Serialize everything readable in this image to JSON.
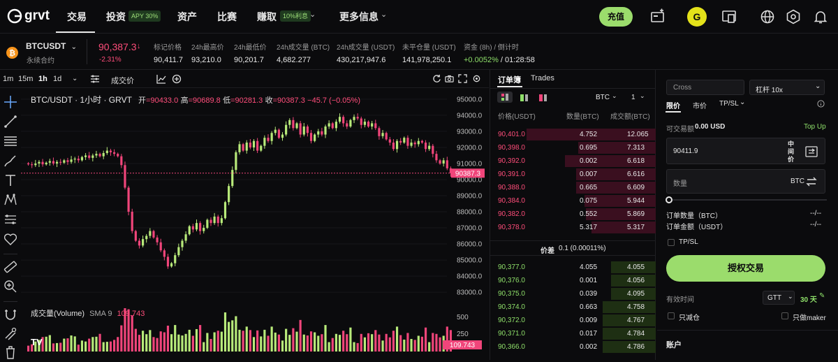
{
  "nav": {
    "logo": "grvt",
    "items": [
      "交易",
      "投资",
      "资产",
      "比赛",
      "赚取",
      "更多信息"
    ],
    "invest_badge": "APY 30%",
    "earn_badge": "10%利息",
    "deposit_label": "充值",
    "avatar_letter": "G"
  },
  "ticker": {
    "symbol": "BTCUSDT",
    "sub": "永续合约",
    "price": "90,387.3",
    "price_arrow": "↓",
    "change": "-2.31%",
    "stats": [
      {
        "label": "标记价格",
        "value": "90,411.7"
      },
      {
        "label": "24h最高价",
        "value": "93,210.0"
      },
      {
        "label": "24h最低价",
        "value": "90,201.7"
      },
      {
        "label": "24h成交量 (BTC)",
        "value": "4,682.277"
      },
      {
        "label": "24h成交量 (USDT)",
        "value": "430,217,947.6"
      },
      {
        "label": "未平仓量 (USDT)",
        "value": "141,978,250.1"
      }
    ],
    "funding_label": "资金 (8h) / 倒计时",
    "funding_rate": "+0.0052%",
    "funding_countdown": "/ 01:28:58"
  },
  "chart_toolbar": {
    "timeframes": [
      "1m",
      "15m",
      "1h",
      "1d"
    ],
    "active_timeframe": "1h",
    "chart_type_label": "成交价"
  },
  "chart": {
    "title": "BTC/USDT · 1小时 · GRVT",
    "ohlc_open_label": "开",
    "ohlc_open": "=90433.0",
    "ohlc_high_label": "高",
    "ohlc_high": "=90689.8",
    "ohlc_low_label": "低",
    "ohlc_low": "=90281.3",
    "ohlc_close_label": "收",
    "ohlc_close": "=90387.3",
    "ohlc_change": "−45.7 (−0.05%)",
    "volume_label": "成交量(Volume)",
    "volume_sma": "SMA 9",
    "volume_value": "109.743",
    "last_price_tag": "90387.3",
    "volume_tag": "109.743",
    "vol_axis": [
      "500",
      "250"
    ],
    "up_color": "#b8ea7a",
    "down_color": "#f0457a"
  },
  "chart_data": {
    "type": "candlestick",
    "title": "BTC/USDT · 1小时 · GRVT",
    "y_ticks": [
      95000,
      94000,
      93000,
      92000,
      91000,
      90000,
      89000,
      88000,
      87000,
      86000,
      85000,
      84000,
      83000
    ],
    "ylim": [
      82700,
      95300
    ],
    "closes": [
      90950,
      90900,
      91000,
      91100,
      90950,
      91050,
      91150,
      91000,
      91100,
      91050,
      91200,
      91100,
      91250,
      91300,
      91200,
      91400,
      91500,
      91350,
      91500,
      91600,
      91450,
      91650,
      91800,
      91700,
      91600,
      91450,
      90900,
      89500,
      88000,
      86800,
      86200,
      85900,
      86300,
      86500,
      86800,
      86400,
      86100,
      85600,
      85200,
      84600,
      84800,
      85300,
      85800,
      86200,
      86600,
      87100,
      86900,
      87300,
      86800,
      87000,
      87500,
      87300,
      87700,
      87300,
      87600,
      88600,
      89600,
      90600,
      91700,
      92200,
      91800,
      92300,
      92000,
      92400,
      91800,
      92100,
      92600,
      92400,
      92900,
      93100,
      92600,
      92800,
      93400,
      93700,
      93200,
      93500,
      92800,
      93300,
      92900,
      92400,
      92800,
      93000,
      92800,
      93300,
      93500,
      93200,
      93600,
      93900,
      93500,
      93300,
      93700,
      93900,
      93800,
      93400,
      93600,
      93300,
      93500,
      93200,
      92700,
      92900,
      92500,
      92300,
      91900,
      92400,
      92300,
      92600,
      92100,
      92300,
      92200,
      92400,
      92300,
      91900,
      92100,
      91600,
      91200,
      91000,
      91200,
      90700,
      90400
    ],
    "volume_max": 600
  },
  "orderbook": {
    "tabs": [
      "订单簿",
      "Trades"
    ],
    "unit": "BTC",
    "group": "1",
    "headers": [
      "价格(USDT)",
      "数量(BTC)",
      "成交额(BTC)"
    ],
    "asks": [
      {
        "price": "90,401.0",
        "qty": "4.752",
        "total": "12.065",
        "depth": 0.78
      },
      {
        "price": "90,398.0",
        "qty": "0.695",
        "total": "7.313",
        "depth": 0.47
      },
      {
        "price": "90,392.0",
        "qty": "0.002",
        "total": "6.618",
        "depth": 0.55
      },
      {
        "price": "90,391.0",
        "qty": "0.007",
        "total": "6.616",
        "depth": 0.48
      },
      {
        "price": "90,388.0",
        "qty": "0.665",
        "total": "6.609",
        "depth": 0.48
      },
      {
        "price": "90,384.0",
        "qty": "0.075",
        "total": "5.944",
        "depth": 0.43
      },
      {
        "price": "90,382.0",
        "qty": "0.552",
        "total": "5.869",
        "depth": 0.42
      },
      {
        "price": "90,378.0",
        "qty": "5.317",
        "total": "5.317",
        "depth": 0.39
      }
    ],
    "spread_label": "价差",
    "spread_value": "0.1 (0.00011%)",
    "bids": [
      {
        "price": "90,377.0",
        "qty": "4.055",
        "total": "4.055",
        "depth": 0.27
      },
      {
        "price": "90,376.0",
        "qty": "0.001",
        "total": "4.056",
        "depth": 0.27
      },
      {
        "price": "90,375.0",
        "qty": "0.039",
        "total": "4.095",
        "depth": 0.27
      },
      {
        "price": "90,374.0",
        "qty": "0.663",
        "total": "4.758",
        "depth": 0.32
      },
      {
        "price": "90,372.0",
        "qty": "0.009",
        "total": "4.767",
        "depth": 0.32
      },
      {
        "price": "90,371.0",
        "qty": "0.017",
        "total": "4.784",
        "depth": 0.32
      },
      {
        "price": "90,366.0",
        "qty": "0.002",
        "total": "4.786",
        "depth": 0.32
      }
    ]
  },
  "trade": {
    "margin_mode": "Cross",
    "leverage": "杠杆 10x",
    "order_types": [
      "限价",
      "市价",
      "TP/SL"
    ],
    "available_label": "可交易额",
    "available_value": "0.00 USD",
    "topup": "Top Up",
    "price_value": "90411.9",
    "mid_label": "中间价",
    "qty_placeholder": "数量",
    "qty_unit": "BTC",
    "order_qty_label": "订单数量（BTC）",
    "order_value_label": "订单金额（USDT）",
    "order_qty_value": "--/--",
    "order_value_value": "--/--",
    "tpsl_label": "TP/SL",
    "submit_label": "授权交易",
    "validity_label": "有效时间",
    "validity_value": "GTT",
    "validity_days": "30 天",
    "reduce_only": "只减仓",
    "maker_only": "只做maker",
    "account_label": "账户"
  }
}
